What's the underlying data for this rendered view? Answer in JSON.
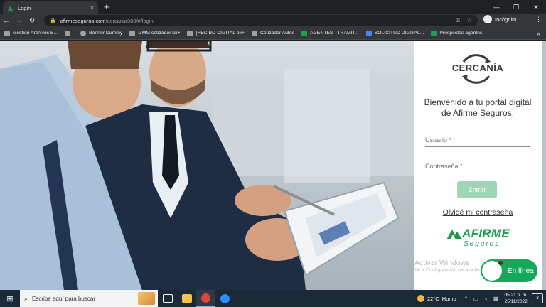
{
  "browser": {
    "tab_title": "Login",
    "tab_close": "×",
    "new_tab": "+",
    "url_host": "afirmeseguros.com",
    "url_path": "/cercania360/#/login",
    "incognito_label": "Incógnito",
    "window_controls": [
      "—",
      "❐",
      "✕"
    ],
    "bookmarks": [
      {
        "label": "Gestion Archivos B...",
        "color": "#9aa0a6"
      },
      {
        "label": "",
        "color": "#9aa0a6"
      },
      {
        "label": "Banner Dummy",
        "color": "#9aa0a6"
      },
      {
        "label": "GMM cotizador bx+",
        "color": "#9aa0a6"
      },
      {
        "label": "[RECIBO DIGITAL bx+",
        "color": "#9aa0a6"
      },
      {
        "label": "Cotizador Autos",
        "color": "#9aa0a6"
      },
      {
        "label": "AGENTES - TRAMIT...",
        "color": "#1e9d54"
      },
      {
        "label": "SOLICITUD DIGITAL...",
        "color": "#4285f4"
      },
      {
        "label": "Prospectos agentes",
        "color": "#1e9d54"
      }
    ],
    "bookmarks_more": "»"
  },
  "login": {
    "brand_logo_text": "CERCANÍA",
    "welcome": "Bienvenido a tu portal digital de Afirme Seguros.",
    "username_placeholder": "Usuario *",
    "password_placeholder": "Contraseña *",
    "submit_label": "Entrar",
    "forgot_label": "Olvidé mi contraseña",
    "company_logo_text": "AFIRME",
    "company_logo_sub": "Seguros",
    "accent_color": "#1a9a4a"
  },
  "overlay": {
    "activate_title": "Activar Windows",
    "activate_sub": "Ve a Configuración para activar Windows.",
    "chat_label": "En línea"
  },
  "taskbar": {
    "search_placeholder": "Escribe aquí para buscar",
    "weather_temp": "22°C",
    "weather_desc": "Humo",
    "time": "05:21 p. m.",
    "date": "25/11/2022",
    "notification_count": "2"
  }
}
